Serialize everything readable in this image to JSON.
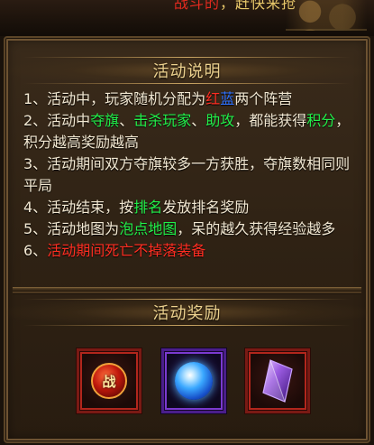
{
  "top_text": {
    "highlight": "战斗的",
    "rest": "，赶快来抢"
  },
  "description": {
    "title": "活动说明",
    "rules": [
      [
        {
          "text": "1、活动中，玩家随机分配为",
          "color": "default"
        },
        {
          "text": "红",
          "color": "red"
        },
        {
          "text": "蓝",
          "color": "blue"
        },
        {
          "text": "两个阵营",
          "color": "default"
        }
      ],
      [
        {
          "text": "2、活动中",
          "color": "default"
        },
        {
          "text": "夺旗",
          "color": "green"
        },
        {
          "text": "、",
          "color": "default"
        },
        {
          "text": "击杀玩家",
          "color": "green"
        },
        {
          "text": "、",
          "color": "default"
        },
        {
          "text": "助攻",
          "color": "green"
        },
        {
          "text": "，都能获得",
          "color": "default"
        },
        {
          "text": "积分",
          "color": "green"
        },
        {
          "text": "，积分越高奖励越高",
          "color": "default"
        }
      ],
      [
        {
          "text": "3、活动期间双方夺旗较多一方获胜，夺旗数相同则平局",
          "color": "default"
        }
      ],
      [
        {
          "text": "4、活动结束，按",
          "color": "default"
        },
        {
          "text": "排名",
          "color": "green"
        },
        {
          "text": "发放排名奖励",
          "color": "default"
        }
      ],
      [
        {
          "text": "5、活动地图为",
          "color": "default"
        },
        {
          "text": "泡点地图",
          "color": "green"
        },
        {
          "text": "，呆的越久获得经验越多",
          "color": "default"
        }
      ],
      [
        {
          "text": "6、",
          "color": "default"
        },
        {
          "text": "活动期间死亡不掉落装备",
          "color": "red"
        }
      ]
    ]
  },
  "reward": {
    "title": "活动奖励",
    "items": [
      {
        "icon": "war-badge-icon",
        "glyph": "战",
        "frame": "red"
      },
      {
        "icon": "blue-orb-icon",
        "glyph": "",
        "frame": "purple"
      },
      {
        "icon": "purple-crystal-icon",
        "glyph": "",
        "frame": "red"
      }
    ]
  },
  "colors": {
    "default": "#f2e8d2",
    "red": "#ff2e22",
    "blue": "#2f72ff",
    "green": "#22f04a",
    "title": "#ecd18e"
  }
}
